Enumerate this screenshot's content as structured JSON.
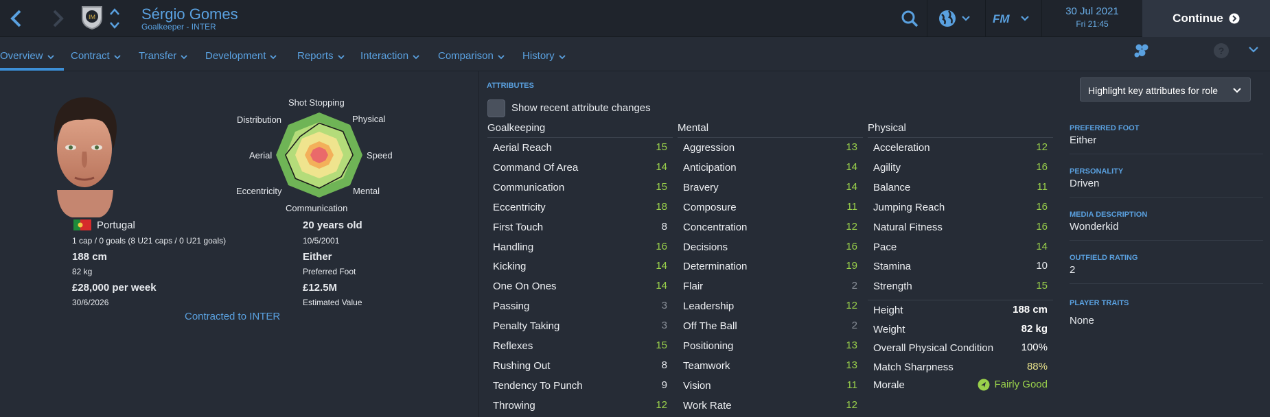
{
  "header": {
    "player_name": "Sérgio Gomes",
    "subtitle": "Goalkeeper - INTER",
    "date": "30 Jul 2021",
    "time": "Fri 21:45",
    "continue_label": "Continue",
    "fm_logo": "FM",
    "icons": [
      "back-arrow-icon",
      "forward-arrow-icon",
      "club-crest-icon",
      "search-icon",
      "globe-icon",
      "fm-logo-icon",
      "continue-arrow-icon"
    ]
  },
  "tabs": [
    "Overview",
    "Contract",
    "Transfer",
    "Development",
    "Reports",
    "Interaction",
    "Comparison",
    "History"
  ],
  "profile": {
    "nationality": "Portugal",
    "caps": "1 cap / 0 goals (8 U21 caps / 0 U21 goals)",
    "height": "188 cm",
    "weight": "82 kg",
    "wage": "£28,000 per week",
    "contract_end": "30/6/2026",
    "age": "20 years old",
    "dob": "10/5/2001",
    "foot": "Either",
    "foot_label": "Preferred Foot",
    "value": "£12.5M",
    "value_label": "Estimated Value",
    "contracted": "Contracted to INTER"
  },
  "radar": {
    "labels": {
      "shot_stopping": "Shot Stopping",
      "physical": "Physical",
      "speed": "Speed",
      "mental": "Mental",
      "communication": "Communication",
      "eccentricity": "Eccentricity",
      "aerial": "Aerial",
      "distribution": "Distribution"
    },
    "values": [
      0.75,
      0.78,
      0.78,
      0.72,
      0.78,
      0.78,
      0.78,
      0.62
    ]
  },
  "attributes": {
    "section_title": "ATTRIBUTES",
    "show_changes_label": "Show recent attribute changes",
    "highlight_label": "Highlight key attributes for role",
    "goalkeeping_title": "Goalkeeping",
    "mental_title": "Mental",
    "physical_title": "Physical",
    "goalkeeping": [
      {
        "name": "Aerial Reach",
        "value": "15"
      },
      {
        "name": "Command Of Area",
        "value": "14"
      },
      {
        "name": "Communication",
        "value": "15"
      },
      {
        "name": "Eccentricity",
        "value": "18"
      },
      {
        "name": "First Touch",
        "value": "8"
      },
      {
        "name": "Handling",
        "value": "16"
      },
      {
        "name": "Kicking",
        "value": "14"
      },
      {
        "name": "One On Ones",
        "value": "14"
      },
      {
        "name": "Passing",
        "value": "3"
      },
      {
        "name": "Penalty Taking",
        "value": "3"
      },
      {
        "name": "Reflexes",
        "value": "15"
      },
      {
        "name": "Rushing Out",
        "value": "8"
      },
      {
        "name": "Tendency To Punch",
        "value": "9"
      },
      {
        "name": "Throwing",
        "value": "12"
      }
    ],
    "mental": [
      {
        "name": "Aggression",
        "value": "13"
      },
      {
        "name": "Anticipation",
        "value": "14"
      },
      {
        "name": "Bravery",
        "value": "14"
      },
      {
        "name": "Composure",
        "value": "11"
      },
      {
        "name": "Concentration",
        "value": "12"
      },
      {
        "name": "Decisions",
        "value": "16"
      },
      {
        "name": "Determination",
        "value": "19"
      },
      {
        "name": "Flair",
        "value": "2"
      },
      {
        "name": "Leadership",
        "value": "12"
      },
      {
        "name": "Off The Ball",
        "value": "2"
      },
      {
        "name": "Positioning",
        "value": "13"
      },
      {
        "name": "Teamwork",
        "value": "13"
      },
      {
        "name": "Vision",
        "value": "11"
      },
      {
        "name": "Work Rate",
        "value": "12"
      }
    ],
    "physical": [
      {
        "name": "Acceleration",
        "value": "12"
      },
      {
        "name": "Agility",
        "value": "16"
      },
      {
        "name": "Balance",
        "value": "11"
      },
      {
        "name": "Jumping Reach",
        "value": "16"
      },
      {
        "name": "Natural Fitness",
        "value": "16"
      },
      {
        "name": "Pace",
        "value": "14"
      },
      {
        "name": "Stamina",
        "value": "10"
      },
      {
        "name": "Strength",
        "value": "15"
      }
    ],
    "physical_extra": [
      {
        "name": "Height",
        "value": "188 cm"
      },
      {
        "name": "Weight",
        "value": "82 kg"
      },
      {
        "name": "Overall Physical Condition",
        "value": "100%"
      },
      {
        "name": "Match Sharpness",
        "value": "88%"
      },
      {
        "name": "Morale",
        "value": "Fairly Good"
      }
    ]
  },
  "side": {
    "preferred_foot_label": "PREFERRED FOOT",
    "preferred_foot": "Either",
    "personality_label": "PERSONALITY",
    "personality": "Driven",
    "media_label": "MEDIA DESCRIPTION",
    "media": "Wonderkid",
    "outfield_label": "OUTFIELD RATING",
    "outfield": "2",
    "traits_label": "PLAYER TRAITS",
    "traits": "None"
  },
  "colors": {
    "accent": "#5aa1e0",
    "tier_high": "#9ad14b",
    "tier_mid": "#e8ebef",
    "tier_low": "#8a9099",
    "sharpness": "#e6e08a",
    "morale": "#9ad14b"
  }
}
